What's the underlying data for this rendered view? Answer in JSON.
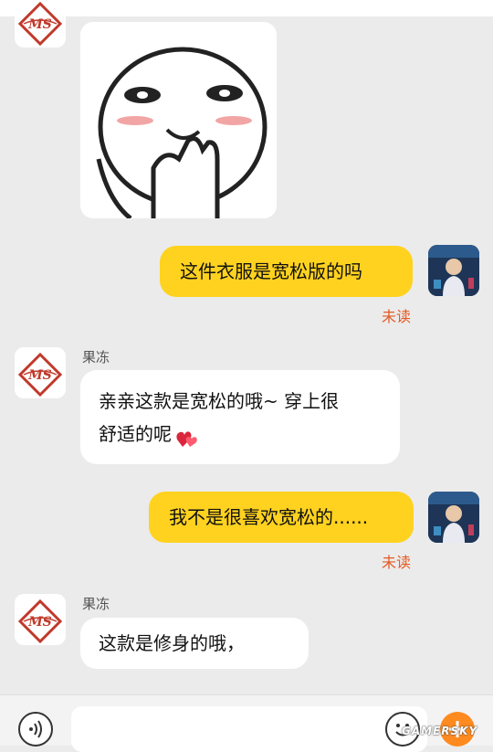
{
  "seller": {
    "name": "果冻"
  },
  "messages": [
    {
      "from": "seller",
      "type": "sticker",
      "sticker": "shy-face-sticker"
    },
    {
      "from": "user",
      "text": "这件衣服是宽松版的吗",
      "status": "未读"
    },
    {
      "from": "seller",
      "sender": "果冻",
      "lines": [
        "亲亲这款是宽松的哦~ 穿上很",
        "舒适的呢"
      ],
      "emoji": "heart-emoji"
    },
    {
      "from": "user",
      "text": "我不是很喜欢宽松的......",
      "status": "未读"
    },
    {
      "from": "seller",
      "sender": "果冻",
      "text": "这款是修身的哦，"
    }
  ],
  "input": {
    "placeholder": ""
  },
  "watermark": "GAMERSKY",
  "colors": {
    "user_bubble": "#ffd21f",
    "seller_bubble": "#ffffff",
    "unread": "#e35a24",
    "plus": "#ff8a1f"
  },
  "icons": [
    "voice-icon",
    "emoji-icon",
    "plus-icon"
  ]
}
